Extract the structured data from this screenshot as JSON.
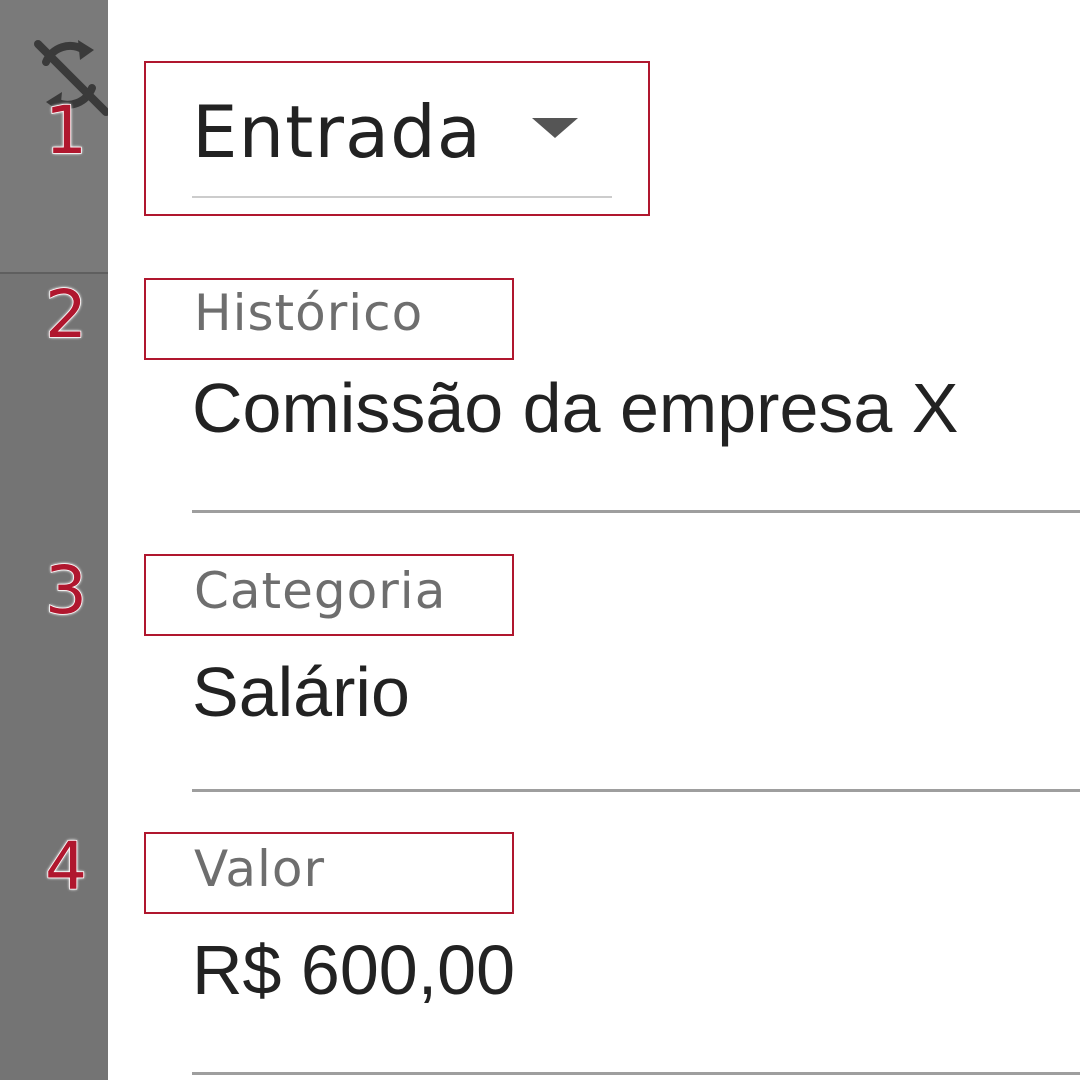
{
  "steps": [
    "1",
    "2",
    "3",
    "4"
  ],
  "type_dropdown": {
    "value": "Entrada"
  },
  "historico": {
    "label": "Histórico",
    "value": "Comissão da empresa X"
  },
  "categoria": {
    "label": "Categoria",
    "value": "Salário"
  },
  "valor": {
    "label": "Valor",
    "value": "R$ 600,00"
  },
  "icons": {
    "sidebar": "sync-disabled-icon",
    "dropdown": "caret-down-icon"
  },
  "colors": {
    "highlight": "#b0172e",
    "sidebar": "#747474",
    "text": "#222222",
    "label": "#6e6e6e"
  }
}
